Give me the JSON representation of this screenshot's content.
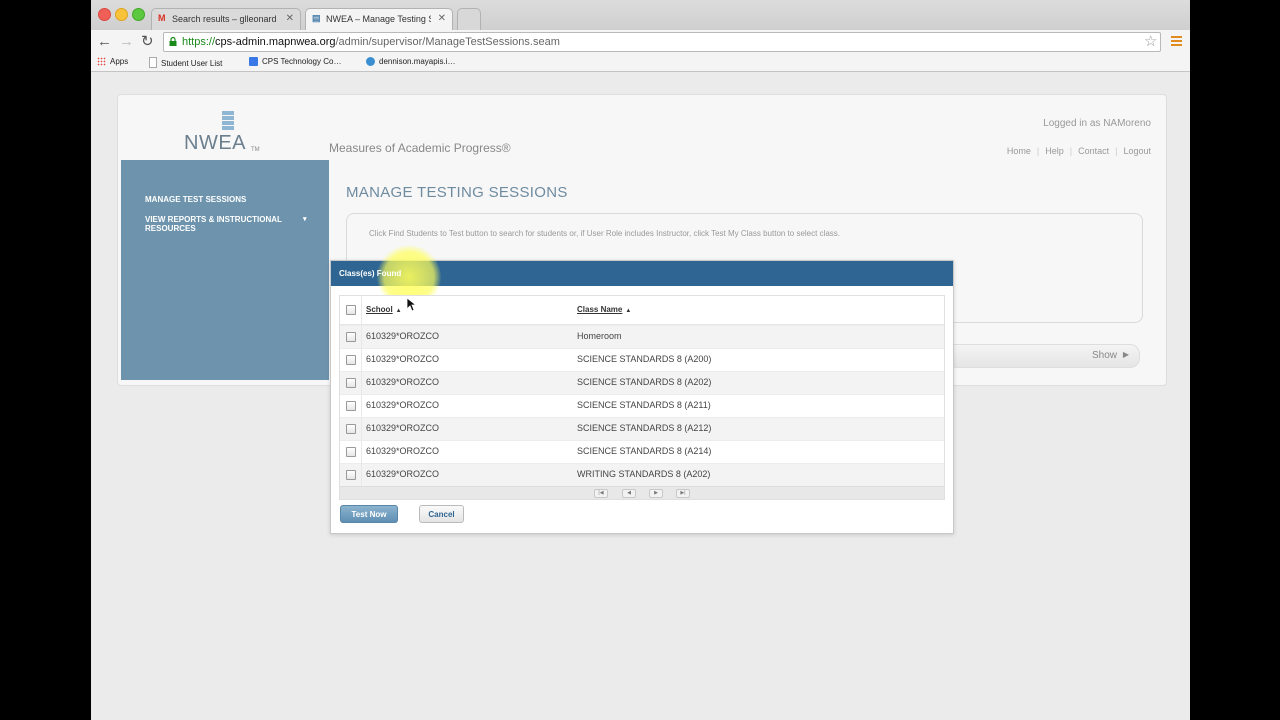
{
  "browser": {
    "tabs": [
      {
        "title": "Search results – glleonard",
        "favicon": "gmail-icon"
      },
      {
        "title": "NWEA – Manage Testing Se",
        "favicon": "nwea-icon"
      }
    ],
    "url": {
      "scheme": "https://",
      "host": "cps-admin.mapnwea.org",
      "path": "/admin/supervisor/ManageTestSessions.seam"
    },
    "bookmarks": [
      "Apps",
      "Student User List",
      "CPS Technology Co…",
      "dennison.mayapis.i…"
    ],
    "colors": {
      "url_secure": "#1a8a1a",
      "menu_icon": "#e28b1f"
    }
  },
  "app": {
    "logo_text": "NWEA",
    "logo_tm": "TM",
    "tagline": "Measures of Academic Progress®",
    "logged_in": "Logged in as NAMoreno",
    "topnav": [
      "Home",
      "Help",
      "Contact",
      "Logout"
    ],
    "sidebar": [
      {
        "label": "MANAGE TEST SESSIONS"
      },
      {
        "label": "VIEW REPORTS & INSTRUCTIONAL RESOURCES",
        "has_dropdown": true
      }
    ],
    "page_title": "MANAGE TESTING SESSIONS",
    "instructions": "Click Find Students to Test button to search for students or, if User Role includes Instructor, click Test My Class button to select class.",
    "show_label": "Show",
    "colors": {
      "sidebar": "#6e94ad",
      "header": "#2e6592",
      "heading": "#6e8ba0"
    }
  },
  "modal": {
    "title": "Class(es) Found",
    "columns": {
      "school": "School",
      "class_name": "Class Name"
    },
    "rows": [
      {
        "school": "610329*OROZCO",
        "class": "Homeroom"
      },
      {
        "school": "610329*OROZCO",
        "class": "SCIENCE STANDARDS 8 (A200)"
      },
      {
        "school": "610329*OROZCO",
        "class": "SCIENCE STANDARDS 8 (A202)"
      },
      {
        "school": "610329*OROZCO",
        "class": "SCIENCE STANDARDS 8 (A211)"
      },
      {
        "school": "610329*OROZCO",
        "class": "SCIENCE STANDARDS 8 (A212)"
      },
      {
        "school": "610329*OROZCO",
        "class": "SCIENCE STANDARDS 8 (A214)"
      },
      {
        "school": "610329*OROZCO",
        "class": "WRITING STANDARDS 8 (A202)"
      }
    ],
    "buttons": {
      "test_now": "Test Now",
      "cancel": "Cancel"
    }
  }
}
